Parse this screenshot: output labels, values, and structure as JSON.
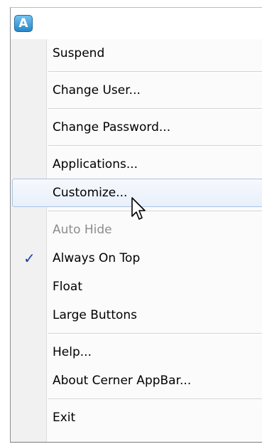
{
  "app": {
    "icon_letter": "A",
    "icon_name": "appbar-logo-icon"
  },
  "menu": {
    "suspend": "Suspend",
    "change_user": "Change User...",
    "change_password": "Change Password...",
    "applications": "Applications...",
    "customize": "Customize...",
    "auto_hide": "Auto Hide",
    "always_on_top": "Always On Top",
    "always_on_top_checked": "✓",
    "float": "Float",
    "large_buttons": "Large Buttons",
    "help": "Help...",
    "about": "About Cerner AppBar...",
    "exit": "Exit"
  },
  "colors": {
    "check": "#1f3f9a",
    "hover_border": "#a9c4e5",
    "disabled_text": "#8c8c8c"
  }
}
